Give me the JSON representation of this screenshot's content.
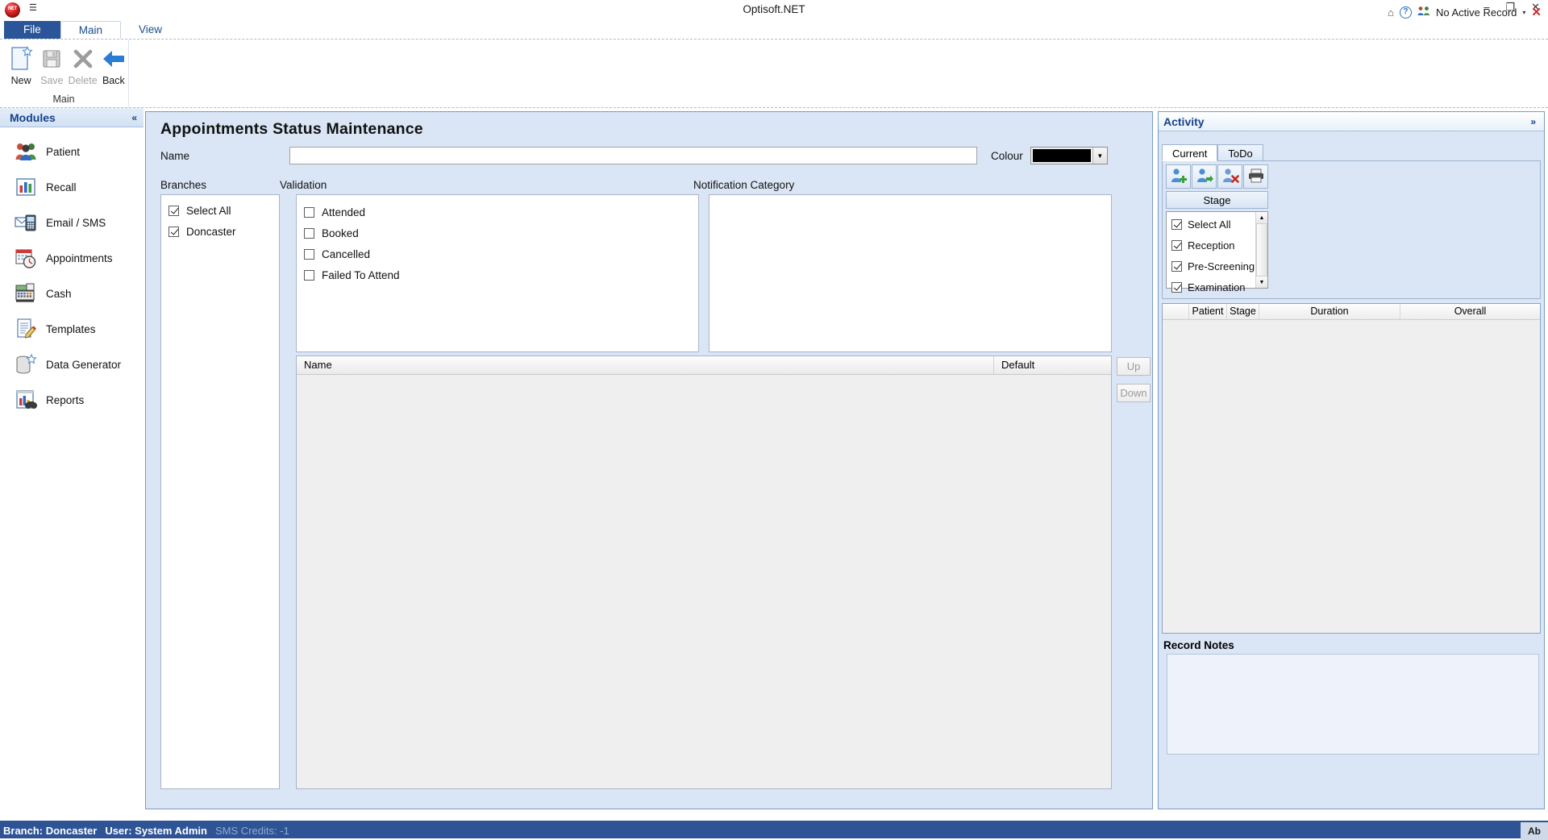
{
  "window": {
    "app_title": "Optisoft.NET",
    "orb_label": "NET",
    "quick_access_icon": "quick-access-toolbar-icon",
    "minimize": "–",
    "restore": "❐",
    "close": "✕"
  },
  "ribbon_status": {
    "home_icon": "home-icon",
    "help_icon": "?",
    "people_icon": "people-icon",
    "record_text": "No Active Record",
    "dropdown_caret": "▾",
    "close_record": "✕"
  },
  "ribbon": {
    "tabs": [
      {
        "label": "File",
        "style": "file"
      },
      {
        "label": "Main",
        "style": "active"
      },
      {
        "label": "View",
        "style": "normal"
      }
    ],
    "group_title": "Main",
    "items": [
      {
        "label": "New",
        "icon": "new-document-icon",
        "enabled": true
      },
      {
        "label": "Save",
        "icon": "save-floppy-icon",
        "enabled": false
      },
      {
        "label": "Delete",
        "icon": "delete-x-icon",
        "enabled": false
      },
      {
        "label": "Back",
        "icon": "back-arrow-icon",
        "enabled": true
      }
    ]
  },
  "modules": {
    "header": "Modules",
    "collapse_icon": "«",
    "items": [
      {
        "label": "Patient",
        "icon": "patients-group-icon"
      },
      {
        "label": "Recall",
        "icon": "bar-chart-icon"
      },
      {
        "label": "Email / SMS",
        "icon": "envelope-phone-icon"
      },
      {
        "label": "Appointments",
        "icon": "calendar-clock-icon"
      },
      {
        "label": "Cash",
        "icon": "cash-register-icon"
      },
      {
        "label": "Templates",
        "icon": "document-pencil-icon"
      },
      {
        "label": "Data Generator",
        "icon": "database-star-icon"
      },
      {
        "label": "Reports",
        "icon": "reports-binoculars-icon"
      }
    ]
  },
  "main": {
    "page_title": "Appointments Status Maintenance",
    "name_label": "Name",
    "name_value": "",
    "colour_label": "Colour",
    "colour_value": "#000000",
    "colour_caret": "▼",
    "branches_label": "Branches",
    "branches": [
      {
        "label": "Select All",
        "checked": true
      },
      {
        "label": "Doncaster",
        "checked": true
      }
    ],
    "validation_label": "Validation",
    "validation": [
      {
        "label": "Attended",
        "checked": false
      },
      {
        "label": "Booked",
        "checked": false
      },
      {
        "label": "Cancelled",
        "checked": false
      },
      {
        "label": "Failed To Attend",
        "checked": false
      }
    ],
    "notification_label": "Notification Category",
    "grid": {
      "columns": [
        "Name",
        "Default"
      ],
      "rows": []
    },
    "up_label": "Up",
    "down_label": "Down"
  },
  "activity": {
    "header": "Activity",
    "expand_icon": "»",
    "tabs": [
      {
        "label": "Current",
        "active": true
      },
      {
        "label": "ToDo",
        "active": false
      }
    ],
    "icon_buttons": [
      {
        "name": "add-patient-icon"
      },
      {
        "name": "move-patient-icon"
      },
      {
        "name": "remove-patient-icon"
      },
      {
        "name": "print-icon"
      }
    ],
    "stage_button": "Stage",
    "stages": [
      {
        "label": "Select All",
        "checked": true
      },
      {
        "label": "Reception",
        "checked": true
      },
      {
        "label": "Pre-Screening",
        "checked": true
      },
      {
        "label": "Examination",
        "checked": true
      }
    ],
    "scroll_up": "▲",
    "scroll_down": "▼",
    "grid_columns": [
      "",
      "Patient",
      "Stage",
      "Duration",
      "Overall"
    ],
    "grid_rows": [],
    "record_notes_title": "Record Notes",
    "record_notes_value": ""
  },
  "statusbar": {
    "branch": "Branch: Doncaster",
    "user": "User: System Admin",
    "sms": "SMS Credits: -1",
    "right_indicator": "Ab"
  }
}
